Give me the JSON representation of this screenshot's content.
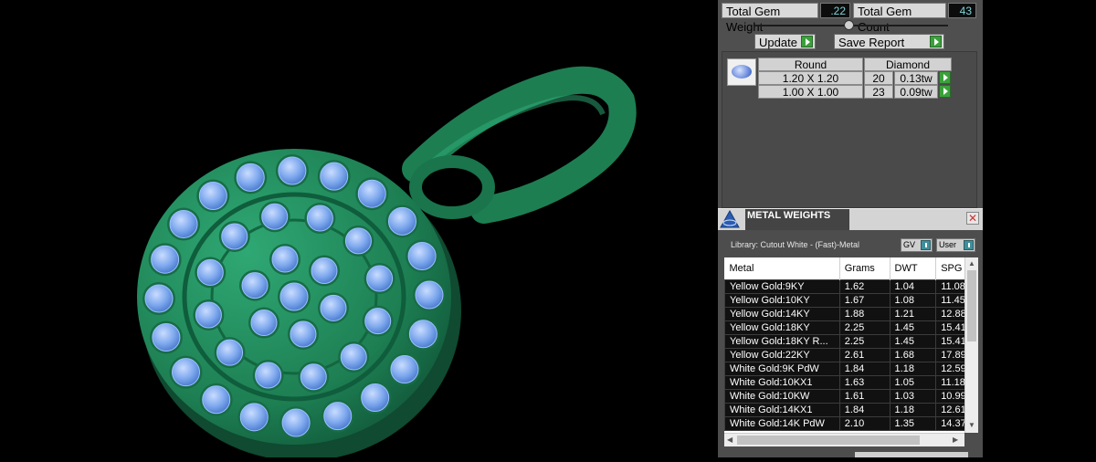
{
  "gem_totals": {
    "weight_label": "Total Gem Weight",
    "weight_value": ".22",
    "count_label": "Total Gem Count",
    "count_value": "43"
  },
  "actions": {
    "update_label": "Update",
    "save_report_label": "Save Report"
  },
  "gem_table": {
    "shape": "Round",
    "stone": "Diamond",
    "rows": [
      {
        "size": "1.20 X 1.20",
        "count": "20",
        "weight": "0.13tw"
      },
      {
        "size": "1.00 X 1.00",
        "count": "23",
        "weight": "0.09tw"
      }
    ]
  },
  "metal_weights": {
    "title": "METAL WEIGHTS",
    "library": "Library: Cutout White - (Fast)-Metal",
    "toggle_gv": "GV",
    "toggle_user": "User",
    "columns": [
      "Metal",
      "Grams",
      "DWT",
      "SPG"
    ],
    "rows": [
      [
        "Yellow Gold:9KY",
        "1.62",
        "1.04",
        "11.08"
      ],
      [
        "Yellow Gold:10KY",
        "1.67",
        "1.08",
        "11.45"
      ],
      [
        "Yellow Gold:14KY",
        "1.88",
        "1.21",
        "12.88"
      ],
      [
        "Yellow Gold:18KY",
        "2.25",
        "1.45",
        "15.41"
      ],
      [
        "Yellow Gold:18KY R...",
        "2.25",
        "1.45",
        "15.41"
      ],
      [
        "Yellow Gold:22KY",
        "2.61",
        "1.68",
        "17.89"
      ],
      [
        "White Gold:9K PdW",
        "1.84",
        "1.18",
        "12.59"
      ],
      [
        "White Gold:10KX1",
        "1.63",
        "1.05",
        "11.18"
      ],
      [
        "White Gold:10KW",
        "1.61",
        "1.03",
        "10.99"
      ],
      [
        "White Gold:14KX1",
        "1.84",
        "1.18",
        "12.61"
      ],
      [
        "White Gold:14K PdW",
        "2.10",
        "1.35",
        "14.37"
      ]
    ]
  },
  "colors": {
    "metal_green": "#1f8a5a",
    "gem_blue": "#7fb0f0",
    "panel_bg": "#4f4f4f"
  }
}
